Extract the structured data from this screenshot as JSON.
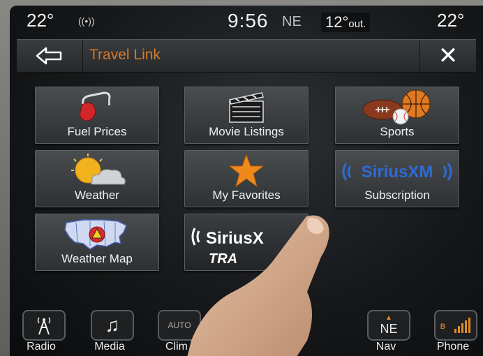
{
  "status": {
    "temp_left": "22°",
    "time": "9:56",
    "compass": "NE",
    "outside_temp": "12°",
    "outside_suffix": "out.",
    "temp_right": "22°"
  },
  "header": {
    "title": "Travel Link"
  },
  "tiles": [
    {
      "label": "Fuel Prices"
    },
    {
      "label": "Movie Listings"
    },
    {
      "label": "Sports"
    },
    {
      "label": "Weather"
    },
    {
      "label": "My Favorites"
    },
    {
      "label": "Subscription"
    },
    {
      "label": "Weather Map"
    },
    {
      "label": "SiriusXM Travel Link"
    }
  ],
  "logos": {
    "siriusxm": "SiriusXM",
    "sirius_partial": "SiriusX",
    "travel_partial": "TRA"
  },
  "dock": [
    {
      "label": "Radio"
    },
    {
      "label": "Media"
    },
    {
      "label": "Clim",
      "icon_text": "AUTO"
    },
    {
      "label": "Nav",
      "icon_text": "NE"
    },
    {
      "label": "Phone"
    }
  ],
  "colors": {
    "accent": "#d5792a",
    "sirius_blue": "#2e6bd6"
  }
}
